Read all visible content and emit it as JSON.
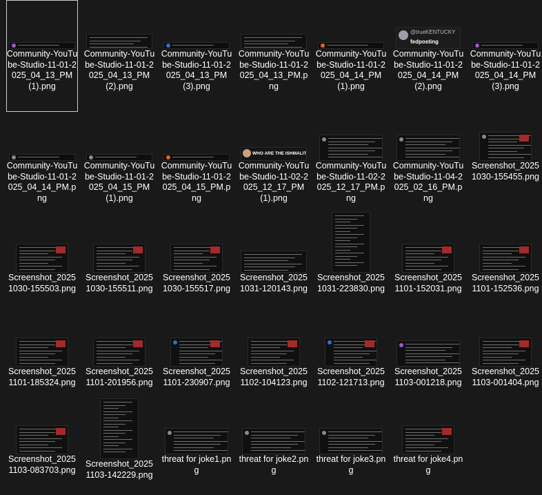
{
  "window": {
    "view": "explorer-large-icons"
  },
  "colors": {
    "background": "#191919",
    "selection_border": "#cfcfcf",
    "accent_red": "#a32a2a",
    "avatar_orange": "#e8612c",
    "avatar_purple": "#9b59d0",
    "avatar_blue": "#2f6fd1"
  },
  "files": [
    {
      "name": "Community-YouTube-Studio-11-01-2025_04_13_PM (1).png",
      "thumb": "thin",
      "avatar": "purple",
      "selected": true
    },
    {
      "name": "Community-YouTube-Studio-11-01-2025_04_13_PM (2).png",
      "thumb": "text",
      "avatar": "none"
    },
    {
      "name": "Community-YouTube-Studio-11-01-2025_04_13_PM (3).png",
      "thumb": "thin",
      "avatar": "blue"
    },
    {
      "name": "Community-YouTube-Studio-11-01-2025_04_13_PM.png",
      "thumb": "text",
      "avatar": "none"
    },
    {
      "name": "Community-YouTube-Studio-11-01-2025_04_14_PM (1).png",
      "thumb": "thin",
      "avatar": "orange"
    },
    {
      "name": "Community-YouTube-Studio-11-01-2025_04_14_PM (2).png",
      "thumb": "tweet",
      "avatar": "gray",
      "thumb_text_1": "@trueKENTUCKY",
      "thumb_text_2": "fedposting"
    },
    {
      "name": "Community-YouTube-Studio-11-01-2025_04_14_PM (3).png",
      "thumb": "thin",
      "avatar": "purple"
    },
    {
      "name": "Community-YouTube-Studio-11-01-2025_04_14_PM.png",
      "thumb": "thin",
      "avatar": "gray"
    },
    {
      "name": "Community-YouTube-Studio-11-01-2025_04_15_PM (1).png",
      "thumb": "thin",
      "avatar": "gray"
    },
    {
      "name": "Community-YouTube-Studio-11-01-2025_04_15_PM.png",
      "thumb": "thin",
      "avatar": "orange"
    },
    {
      "name": "Community-YouTube-Studio-11-02-2025_12_17_PM (1).png",
      "thumb": "ismail",
      "avatar": "gray",
      "thumb_text_1": "WHO ARE THE ISHMALITES?"
    },
    {
      "name": "Community-YouTube-Studio-11-02-2025_12_17_PM.png",
      "thumb": "comment",
      "avatar": "gray"
    },
    {
      "name": "Community-YouTube-Studio-11-04-2025_02_16_PM.png",
      "thumb": "comment",
      "avatar": "gray"
    },
    {
      "name": "Screenshot_20251030-155455.png",
      "thumb": "post",
      "avatar": "gray"
    },
    {
      "name": "Screenshot_20251030-155503.png",
      "thumb": "post",
      "avatar": "none"
    },
    {
      "name": "Screenshot_20251030-155511.png",
      "thumb": "post",
      "avatar": "none"
    },
    {
      "name": "Screenshot_20251030-155517.png",
      "thumb": "post",
      "avatar": "none"
    },
    {
      "name": "Screenshot_20251031-120143.png",
      "thumb": "dark",
      "avatar": "none"
    },
    {
      "name": "Screenshot_20251031-223830.png",
      "thumb": "tall",
      "avatar": "none"
    },
    {
      "name": "Screenshot_20251101-152031.png",
      "thumb": "post",
      "avatar": "none"
    },
    {
      "name": "Screenshot_20251101-152536.png",
      "thumb": "post",
      "avatar": "none"
    },
    {
      "name": "Screenshot_20251101-185324.png",
      "thumb": "post",
      "avatar": "none"
    },
    {
      "name": "Screenshot_20251101-201956.png",
      "thumb": "post",
      "avatar": "none"
    },
    {
      "name": "Screenshot_20251101-230907.png",
      "thumb": "post",
      "avatar": "blue"
    },
    {
      "name": "Screenshot_20251102-104123.png",
      "thumb": "post",
      "avatar": "none"
    },
    {
      "name": "Screenshot_20251102-121713.png",
      "thumb": "post",
      "avatar": "blue"
    },
    {
      "name": "Screenshot_20251103-001218.png",
      "thumb": "comment",
      "avatar": "purple"
    },
    {
      "name": "Screenshot_20251103-001404.png",
      "thumb": "post",
      "avatar": "none"
    },
    {
      "name": "Screenshot_20251103-083703.png",
      "thumb": "post",
      "avatar": "none"
    },
    {
      "name": "Screenshot_20251103-142229.png",
      "thumb": "tall",
      "avatar": "none"
    },
    {
      "name": "threat for joke1.png",
      "thumb": "comment",
      "avatar": "gray"
    },
    {
      "name": "threat for joke2.png",
      "thumb": "comment",
      "avatar": "gray"
    },
    {
      "name": "threat for joke3.png",
      "thumb": "comment",
      "avatar": "gray"
    },
    {
      "name": "threat for joke4.png",
      "thumb": "post",
      "avatar": "none"
    }
  ]
}
